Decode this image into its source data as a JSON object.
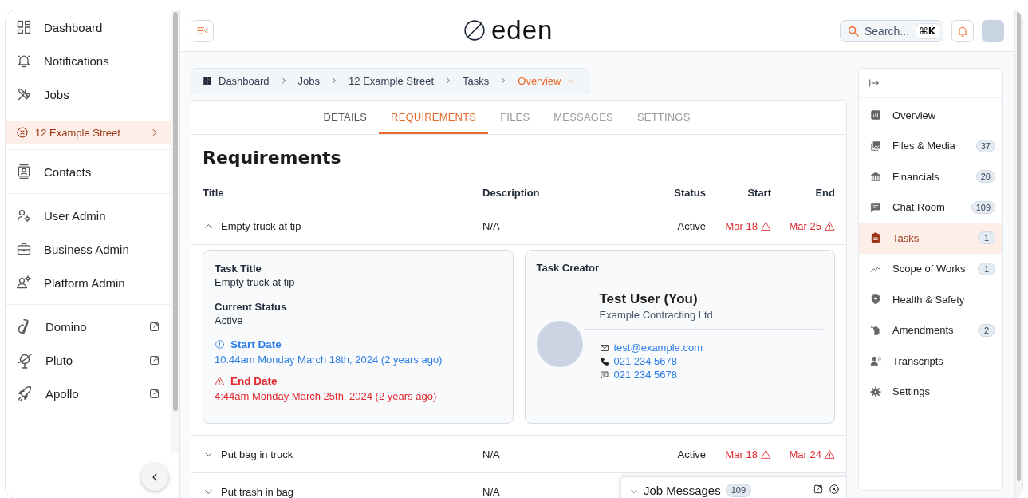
{
  "sidebar": {
    "groups": [
      [
        {
          "kind": "nav",
          "label": "Dashboard",
          "selected": false
        },
        {
          "kind": "nav",
          "label": "Notifications",
          "selected": false
        },
        {
          "kind": "nav",
          "label": "Jobs",
          "selected": false
        }
      ],
      [
        {
          "kind": "job",
          "label": "12 Example Street",
          "selected": true
        }
      ],
      [
        {
          "kind": "nav",
          "label": "Contacts",
          "selected": false
        }
      ],
      [
        {
          "kind": "nav",
          "label": "User Admin",
          "selected": false
        },
        {
          "kind": "nav",
          "label": "Business Admin",
          "selected": false
        },
        {
          "kind": "nav",
          "label": "Platform Admin",
          "selected": false
        }
      ],
      [
        {
          "kind": "external",
          "label": "Domino",
          "selected": false
        },
        {
          "kind": "external",
          "label": "Pluto",
          "selected": false
        },
        {
          "kind": "external",
          "label": "Apollo",
          "selected": false
        }
      ]
    ]
  },
  "header": {
    "logo": "eden",
    "search": {
      "placeholder": "Search...",
      "shortcut": "⌘K"
    }
  },
  "breadcrumb": [
    {
      "label": "Dashboard",
      "current": false
    },
    {
      "label": "Jobs",
      "current": false
    },
    {
      "label": "12 Example Street",
      "current": false
    },
    {
      "label": "Tasks",
      "current": false
    },
    {
      "label": "Overview",
      "current": true
    }
  ],
  "tabs": [
    {
      "label": "DETAILS",
      "selected": false,
      "disabled": false
    },
    {
      "label": "REQUIREMENTS",
      "selected": true,
      "disabled": false
    },
    {
      "label": "FILES",
      "selected": false,
      "disabled": true
    },
    {
      "label": "MESSAGES",
      "selected": false,
      "disabled": true
    },
    {
      "label": "SETTINGS",
      "selected": false,
      "disabled": true
    }
  ],
  "requirements": {
    "title": "Requirements",
    "columns": [
      "Title",
      "Description",
      "Status",
      "Start",
      "End"
    ],
    "rows": [
      {
        "title": "Empty truck at tip",
        "description": "N/A",
        "status": "Active",
        "start": "Mar 18",
        "end": "Mar 25",
        "start_overdue": true,
        "end_overdue": true,
        "expanded": true
      },
      {
        "title": "Put bag in truck",
        "description": "N/A",
        "status": "Active",
        "start": "Mar 18",
        "end": "Mar 24",
        "start_overdue": true,
        "end_overdue": true,
        "expanded": false
      },
      {
        "title": "Put trash in bag",
        "description": "N/A",
        "expanded": false
      }
    ],
    "detail": {
      "fields": [
        {
          "label": "Task Title",
          "value": "Empty truck at tip"
        },
        {
          "label": "Current Status",
          "value": "Active"
        }
      ],
      "dates": [
        {
          "kind": "start",
          "label": "Start Date",
          "value": "10:44am Monday March 18th, 2024 (2 years ago)"
        },
        {
          "kind": "end",
          "label": "End Date",
          "value": "4:44am Monday March 25th, 2024 (2 years ago)"
        }
      ],
      "creator": {
        "heading": "Task Creator",
        "name": "Test User (You)",
        "company": "Example Contracting Ltd",
        "contacts": [
          {
            "kind": "email",
            "value": "test@example.com"
          },
          {
            "kind": "phone",
            "value": "021 234 5678"
          },
          {
            "kind": "sms",
            "value": "021 234 5678"
          }
        ]
      }
    }
  },
  "job_nav": {
    "items": [
      {
        "label": "Overview",
        "selected": false
      },
      {
        "label": "Files & Media",
        "count": "37",
        "selected": false
      },
      {
        "label": "Financials",
        "count": "20",
        "selected": false
      },
      {
        "label": "Chat Room",
        "count": "109",
        "selected": false
      },
      {
        "label": "Tasks",
        "count": "1",
        "selected": true
      },
      {
        "label": "Scope of Works",
        "count": "1",
        "selected": false
      },
      {
        "label": "Health & Safety",
        "selected": false
      },
      {
        "label": "Amendments",
        "count": "2",
        "selected": false
      },
      {
        "label": "Transcripts",
        "selected": false
      },
      {
        "label": "Settings",
        "selected": false
      }
    ]
  },
  "chat_dock": {
    "title": "Job Messages",
    "count": "109",
    "expanded": false
  }
}
